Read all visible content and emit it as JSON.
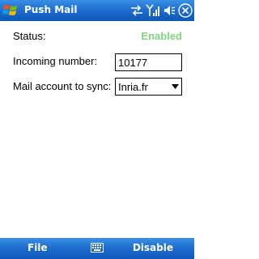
{
  "titlebar": {
    "title": "Push Mail",
    "start_icon": "windows-flag-icon",
    "status_icons": [
      "sync-arrows-icon",
      "signal-antenna-icon",
      "speaker-icon",
      "close-icon"
    ]
  },
  "form": {
    "status_label": "Status:",
    "status_value": "Enabled",
    "incoming_label": "Incoming number:",
    "incoming_value": "10177",
    "mail_label": "Mail account to sync:",
    "mail_selected": "Inria.fr"
  },
  "menubar": {
    "left_softkey": "File",
    "right_softkey": "Disable",
    "center_icon": "keyboard-icon"
  },
  "colors": {
    "bar_blue": "#1f6fd0",
    "status_enabled": "#7ed37e"
  }
}
